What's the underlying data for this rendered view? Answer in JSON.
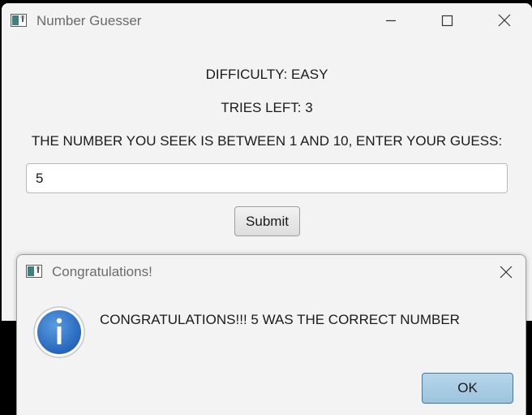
{
  "main_window": {
    "title": "Number Guesser",
    "difficulty_text": "DIFFICULTY: EASY",
    "tries_text": "TRIES LEFT: 3",
    "prompt_text": "THE NUMBER YOU SEEK IS BETWEEN 1 AND 10, ENTER YOUR GUESS:",
    "guess_value": "5",
    "submit_label": "Submit"
  },
  "dialog": {
    "title": "Congratulations!",
    "message": "CONGRATULATIONS!!! 5 WAS THE CORRECT NUMBER",
    "icon": "info-icon",
    "ok_label": "OK"
  },
  "colors": {
    "window_bg": "#f3f3f3",
    "ok_button": "#a9cce3",
    "info_icon": "#2f6fc6"
  }
}
